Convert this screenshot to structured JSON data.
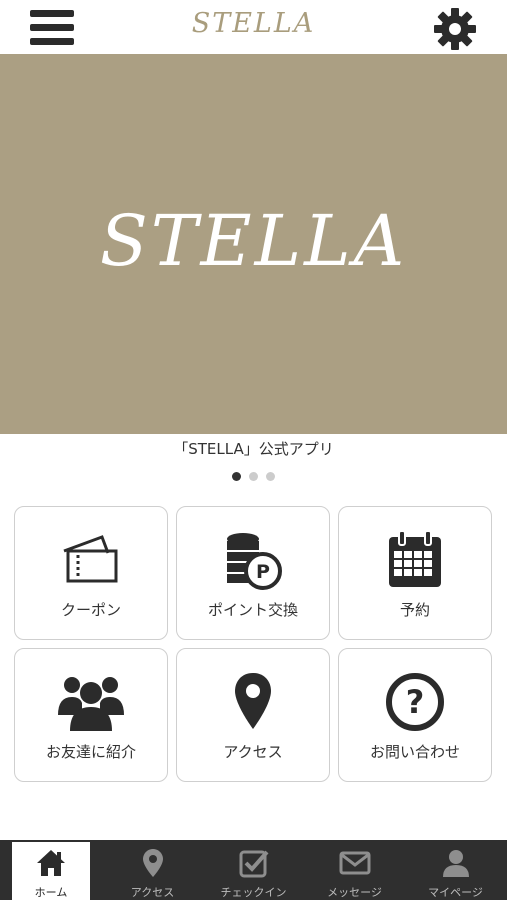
{
  "header": {
    "title": "STELLA"
  },
  "hero": {
    "text": "STELLA"
  },
  "caption": "「STELLA」公式アプリ",
  "menu": {
    "coupon": "クーポン",
    "points": "ポイント交換",
    "reserve": "予約",
    "refer": "お友達に紹介",
    "access": "アクセス",
    "contact": "お問い合わせ"
  },
  "tabs": {
    "home": "ホーム",
    "access": "アクセス",
    "checkin": "チェックイン",
    "message": "メッセージ",
    "mypage": "マイページ"
  },
  "colors": {
    "accent": "#ab9f83",
    "tabbar": "#2f2f2f"
  }
}
